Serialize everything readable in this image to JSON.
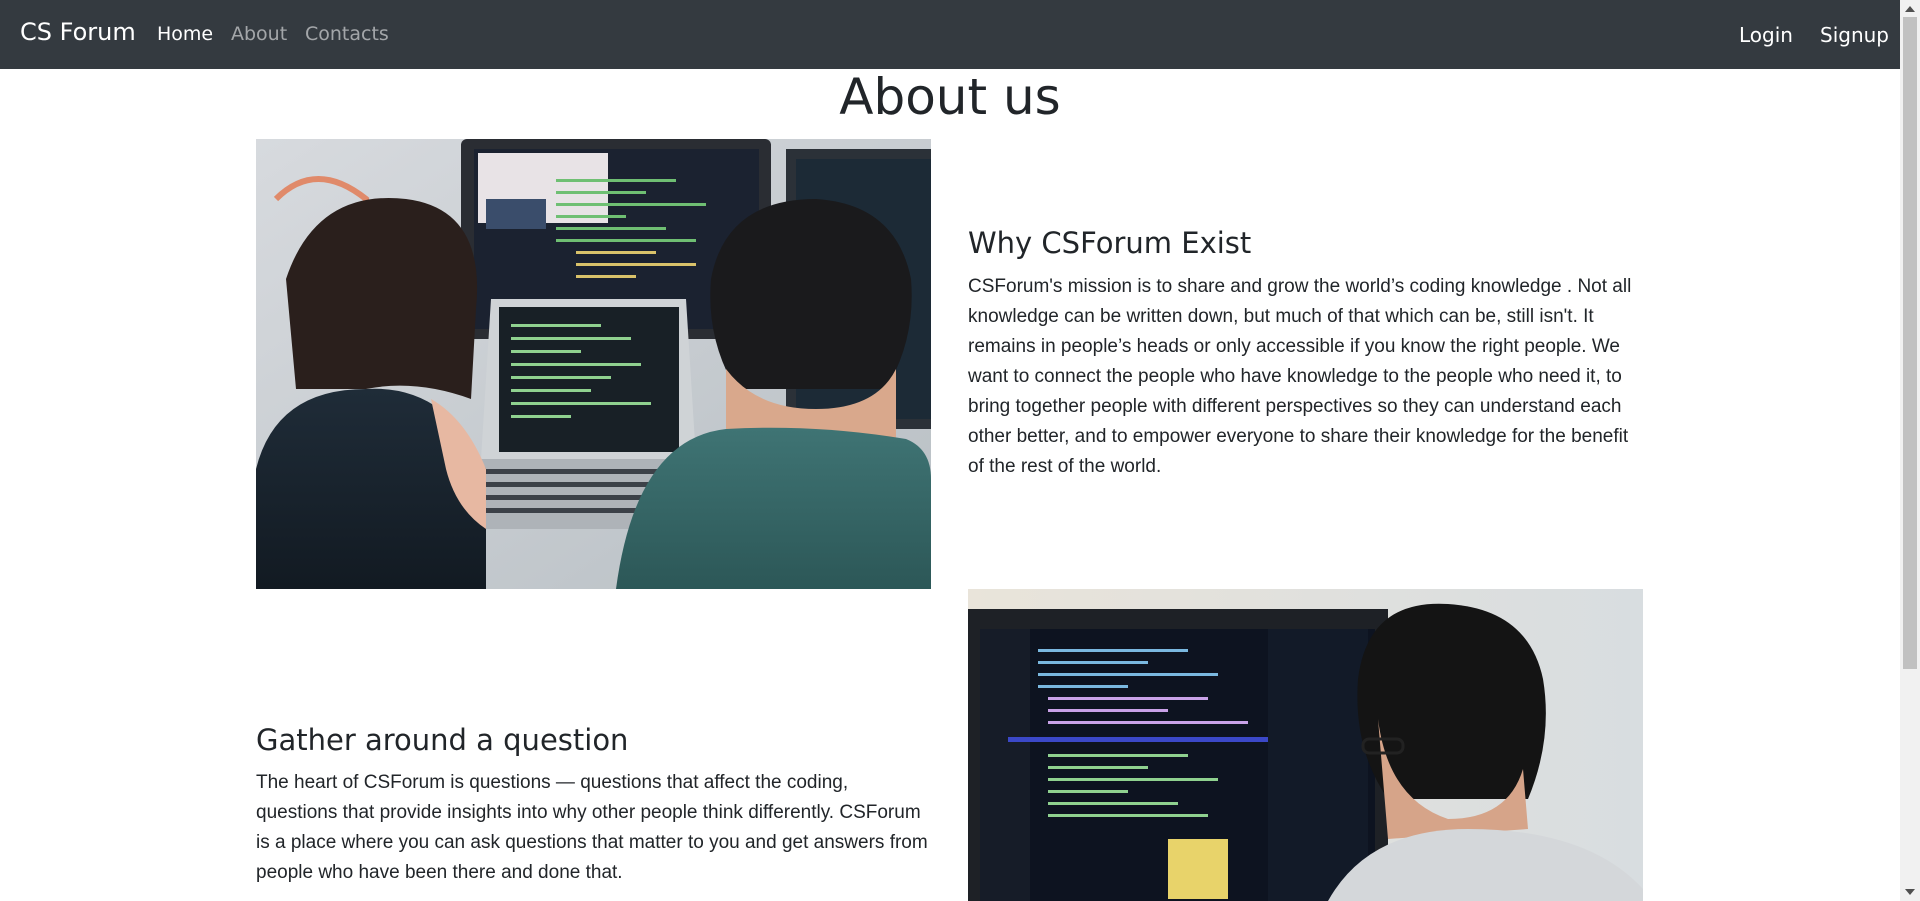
{
  "navbar": {
    "brand": "CS Forum",
    "links": [
      {
        "label": "Home",
        "active": true
      },
      {
        "label": "About",
        "active": false
      },
      {
        "label": "Contacts",
        "active": false
      }
    ],
    "login_label": "Login",
    "signup_label": "Signup"
  },
  "page": {
    "title": "About us"
  },
  "sections": [
    {
      "heading": "Why CSForum Exist",
      "text": "CSForum's mission is to share and grow the world’s coding knowledge . Not all knowledge can be written down, but much of that which can be, still isn't. It remains in people’s heads or only accessible if you know the right people. We want to connect the people who have knowledge to the people who need it, to bring together people with different perspectives so they can understand each other better, and to empower everyone to share their knowledge for the benefit of the rest of the world."
    },
    {
      "heading": "Gather around a question",
      "text": "The heart of CSForum is questions — questions that affect the coding, questions that provide insights into why other people think differently. CSForum is a place where you can ask questions that matter to you and get answers from people who have been there and done that."
    }
  ],
  "colors": {
    "navbar_bg": "#343a40",
    "text": "#212529"
  }
}
